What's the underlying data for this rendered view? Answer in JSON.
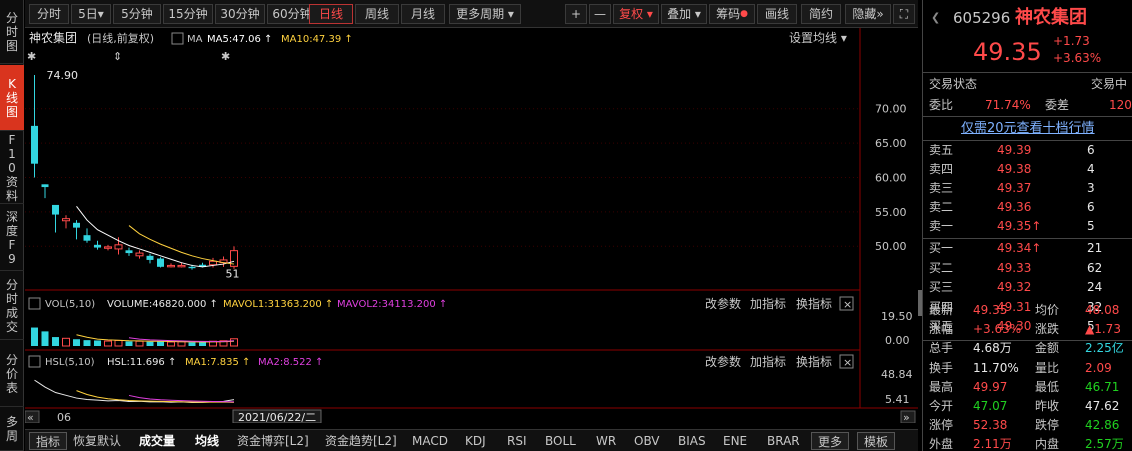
{
  "vtabs": [
    {
      "label": "分时图",
      "active": false
    },
    {
      "label": "K线图",
      "active": true
    },
    {
      "label": "F10资料",
      "active": false
    },
    {
      "label": "深度F9",
      "active": false
    },
    {
      "label": "分时成交",
      "active": false
    },
    {
      "label": "分价表",
      "active": false
    },
    {
      "label": "多周",
      "active": false
    }
  ],
  "toolbar": {
    "periods": [
      "分时",
      "5日▾",
      "5分钟",
      "15分钟",
      "30分钟",
      "60分钟",
      "日线",
      "周线",
      "月线",
      "更多周期 ▾"
    ],
    "active_period": "日线",
    "plus": "+",
    "minus": "—",
    "fuquan": "复权 ▾",
    "diejia": "叠加 ▾",
    "chouma": "筹码",
    "huaxian": "画线",
    "jianyue": "简约",
    "yincang": "隐藏",
    "collapse_icon": "»",
    "expand_icon": "⛶"
  },
  "main_chart": {
    "stock_name": "神农集团",
    "mode": "(日线,前复权)",
    "ma_label": "MA",
    "ma5": "MA5:47.06 ↑",
    "ma10": "MA10:47.39 ↑",
    "settings": "设置均线 ▾",
    "high_label": "74.90",
    "low_label": "51",
    "yticks": [
      "70.00",
      "65.00",
      "60.00",
      "55.00",
      "50.00"
    ]
  },
  "vol_panel": {
    "title": "VOL(5,10)",
    "volume": "VOLUME:46820.000 ↑",
    "mavol1": "MAVOL1:31363.200 ↑",
    "mavol2": "MAVOL2:34113.200 ↑",
    "actions": [
      "改参数",
      "加指标",
      "换指标"
    ],
    "close": "×",
    "yticks": [
      "19.50",
      "0.00"
    ]
  },
  "hsl_panel": {
    "title": "HSL(5,10)",
    "hsl": "HSL:11.696 ↑",
    "ma1": "MA1:7.835 ↑",
    "ma2": "MA2:8.522 ↑",
    "actions": [
      "改参数",
      "加指标",
      "换指标"
    ],
    "close": "×",
    "yticks": [
      "48.84",
      "5.41"
    ]
  },
  "xaxis": {
    "left_arrow": "«",
    "right_arrow": "»",
    "month": "06",
    "date": "2021/06/22/二"
  },
  "bottombar": {
    "items": [
      "指标",
      "恢复默认",
      "成交量",
      "均线",
      "资金博弈[L2]",
      "资金趋势[L2]",
      "MACD",
      "KDJ",
      "RSI",
      "BOLL",
      "WR",
      "OBV",
      "BIAS",
      "ENE",
      "BRAR",
      "更多",
      "模板"
    ]
  },
  "quote": {
    "code": "605296",
    "name": "神农集团",
    "price": "49.35",
    "change": "+1.73",
    "change_pct": "+3.63%",
    "status_label": "交易状态",
    "status_value": "交易中",
    "weibi_label": "委比",
    "weibi_value": "71.74%",
    "weicha_label": "委差",
    "weicha_value": "120",
    "promo": "仅需20元查看十档行情",
    "asks": [
      {
        "label": "卖五",
        "price": "49.39",
        "vol": "6"
      },
      {
        "label": "卖四",
        "price": "49.38",
        "vol": "4"
      },
      {
        "label": "卖三",
        "price": "49.37",
        "vol": "3"
      },
      {
        "label": "卖二",
        "price": "49.36",
        "vol": "6"
      },
      {
        "label": "卖一",
        "price": "49.35↑",
        "vol": "5"
      }
    ],
    "bids": [
      {
        "label": "买一",
        "price": "49.34↑",
        "vol": "21"
      },
      {
        "label": "买二",
        "price": "49.33",
        "vol": "62"
      },
      {
        "label": "买三",
        "price": "49.32",
        "vol": "24"
      },
      {
        "label": "买四",
        "price": "49.31",
        "vol": "32"
      },
      {
        "label": "买五",
        "price": "49.30",
        "vol": "5"
      }
    ],
    "stats": [
      {
        "l1": "最新",
        "v1": "49.35",
        "c1": "red",
        "l2": "均价",
        "v2": "48.08",
        "c2": "red"
      },
      {
        "l1": "涨幅",
        "v1": "+3.63%",
        "c1": "red",
        "l2": "涨跌",
        "v2": "▲1.73",
        "c2": "red"
      },
      {
        "l1": "总手",
        "v1": "4.68万",
        "c1": "white",
        "l2": "金额",
        "v2": "2.25亿",
        "c2": "cyan"
      },
      {
        "l1": "换手",
        "v1": "11.70%",
        "c1": "white",
        "l2": "量比",
        "v2": "2.09",
        "c2": "red"
      },
      {
        "l1": "最高",
        "v1": "49.97",
        "c1": "red",
        "l2": "最低",
        "v2": "46.71",
        "c2": "green"
      },
      {
        "l1": "今开",
        "v1": "47.07",
        "c1": "green",
        "l2": "昨收",
        "v2": "47.62",
        "c2": "white"
      },
      {
        "l1": "涨停",
        "v1": "52.38",
        "c1": "red",
        "l2": "跌停",
        "v2": "42.86",
        "c2": "green"
      },
      {
        "l1": "外盘",
        "v1": "2.11万",
        "c1": "red",
        "l2": "内盘",
        "v2": "2.57万",
        "c2": "green"
      }
    ]
  },
  "chart_data": {
    "type": "candlestick",
    "candles": [
      {
        "o": 62.0,
        "c": 67.5,
        "h": 74.9,
        "l": 60.0,
        "up": false
      },
      {
        "o": 59.0,
        "c": 58.6,
        "h": 59.0,
        "l": 57.0,
        "up": false
      },
      {
        "o": 56.0,
        "c": 54.6,
        "h": 56.0,
        "l": 52.0,
        "up": false
      },
      {
        "o": 54.0,
        "c": 53.7,
        "h": 54.5,
        "l": 52.6,
        "up": true
      },
      {
        "o": 53.4,
        "c": 52.7,
        "h": 53.8,
        "l": 51.0,
        "up": false
      },
      {
        "o": 51.6,
        "c": 50.8,
        "h": 52.6,
        "l": 50.5,
        "up": false
      },
      {
        "o": 50.2,
        "c": 49.8,
        "h": 50.8,
        "l": 49.5,
        "up": false
      },
      {
        "o": 49.9,
        "c": 49.7,
        "h": 50.2,
        "l": 49.4,
        "up": true
      },
      {
        "o": 50.2,
        "c": 49.6,
        "h": 51.3,
        "l": 48.8,
        "up": true
      },
      {
        "o": 49.4,
        "c": 49.0,
        "h": 49.8,
        "l": 48.6,
        "up": false
      },
      {
        "o": 49.0,
        "c": 48.6,
        "h": 49.4,
        "l": 48.2,
        "up": true
      },
      {
        "o": 48.6,
        "c": 48.0,
        "h": 48.9,
        "l": 47.5,
        "up": false
      },
      {
        "o": 48.2,
        "c": 47.0,
        "h": 48.4,
        "l": 46.9,
        "up": false
      },
      {
        "o": 47.2,
        "c": 47.0,
        "h": 47.5,
        "l": 46.9,
        "up": true
      },
      {
        "o": 47.0,
        "c": 47.2,
        "h": 47.6,
        "l": 46.9,
        "up": true
      },
      {
        "o": 47.0,
        "c": 46.8,
        "h": 47.3,
        "l": 46.6,
        "up": false
      },
      {
        "o": 47.3,
        "c": 47.0,
        "h": 47.6,
        "l": 46.9,
        "up": false
      },
      {
        "o": 47.3,
        "c": 47.8,
        "h": 48.3,
        "l": 46.9,
        "up": true
      },
      {
        "o": 47.6,
        "c": 48.0,
        "h": 48.5,
        "l": 47.0,
        "up": true
      },
      {
        "o": 47.07,
        "c": 49.35,
        "h": 49.97,
        "l": 46.71,
        "up": true
      }
    ],
    "ma5": [
      null,
      null,
      null,
      null,
      55.8,
      53.8,
      52.4,
      51.6,
      50.8,
      50.1,
      49.6,
      49.1,
      48.6,
      48.1,
      47.6,
      47.2,
      47.0,
      47.2,
      47.4,
      47.8
    ],
    "ma10": [
      null,
      null,
      null,
      null,
      null,
      null,
      null,
      null,
      null,
      53.0,
      51.8,
      51.0,
      50.3,
      49.7,
      49.1,
      48.6,
      48.2,
      47.9,
      47.6,
      47.4
    ],
    "volume": [
      12.0,
      9.5,
      5.8,
      5.0,
      4.4,
      3.8,
      3.6,
      3.2,
      3.6,
      3.0,
      3.1,
      2.8,
      2.9,
      2.6,
      2.8,
      2.4,
      2.5,
      3.1,
      3.4,
      4.7
    ],
    "mavol1": [
      null,
      null,
      null,
      null,
      7.3,
      5.7,
      4.5,
      4.0,
      3.7,
      3.4,
      3.3,
      3.1,
      3.1,
      2.9,
      2.8,
      2.7,
      2.6,
      2.7,
      2.8,
      3.1
    ],
    "mavol2": [
      null,
      null,
      null,
      null,
      null,
      null,
      null,
      null,
      null,
      5.4,
      4.5,
      4.0,
      3.7,
      3.5,
      3.3,
      3.1,
      3.0,
      2.9,
      3.0,
      3.4
    ],
    "hsl": [
      40.0,
      30.0,
      22.0,
      18.0,
      14.0,
      12.0,
      11.0,
      10.0,
      10.5,
      9.0,
      9.3,
      8.5,
      8.6,
      8.0,
      8.4,
      7.6,
      7.8,
      8.5,
      9.2,
      11.7
    ],
    "hsl_ma1": [
      null,
      null,
      null,
      null,
      24.8,
      19.2,
      15.4,
      13.0,
      11.5,
      10.5,
      10.0,
      9.5,
      9.2,
      8.8,
      8.6,
      8.2,
      8.1,
      8.1,
      8.3,
      7.8
    ],
    "hsl_ma2": [
      null,
      null,
      null,
      null,
      null,
      null,
      null,
      null,
      null,
      17.8,
      14.6,
      12.6,
      11.5,
      10.8,
      10.3,
      9.8,
      9.4,
      9.1,
      8.9,
      8.5
    ],
    "price_range": [
      44.5,
      76.5
    ],
    "vol_range": [
      0,
      19.5
    ],
    "hsl_range": [
      5.41,
      48.84
    ],
    "colors": {
      "up": "#ff4a4a",
      "down": "#33d6e0",
      "ma5": "#ffffff",
      "ma10": "#ffd23f",
      "mavol1": "#ffd23f",
      "mavol2": "#e040e0"
    }
  }
}
